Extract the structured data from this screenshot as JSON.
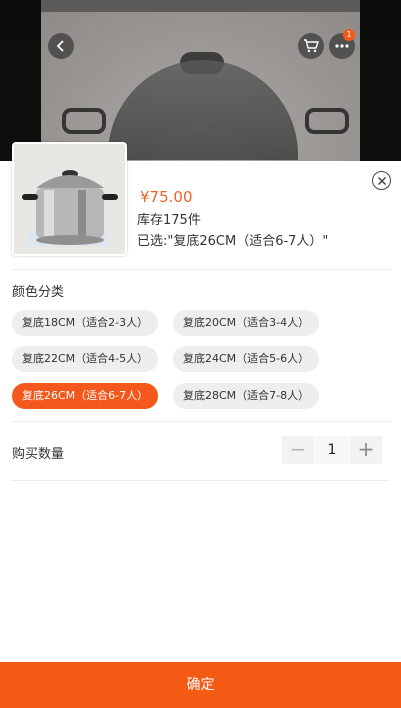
{
  "header": {
    "cart_badge": "1",
    "icons": [
      "back-arrow-icon",
      "cart-icon",
      "more-icon"
    ]
  },
  "product": {
    "price": "¥75.00",
    "stock": "库存175件",
    "selected": "已选:\"复底26CM（适合6-7人）\""
  },
  "color_section": {
    "title": "颜色分类",
    "options": [
      {
        "label": "复底18CM（适合2-3人）",
        "selected": false
      },
      {
        "label": "复底20CM（适合3-4人）",
        "selected": false
      },
      {
        "label": "复底22CM（适合4-5人）",
        "selected": false
      },
      {
        "label": "复底24CM（适合5-6人）",
        "selected": false
      },
      {
        "label": "复底26CM（适合6-7人）",
        "selected": true
      },
      {
        "label": "复底28CM（适合7-8人）",
        "selected": false
      }
    ]
  },
  "quantity": {
    "label": "购买数量",
    "minus": "−",
    "value": "1",
    "plus": "+"
  },
  "footer": {
    "confirm_label": "确定"
  },
  "colors": {
    "accent": "#F55A15",
    "chip_bg": "#EEEEEE",
    "price": "#F0642A"
  }
}
